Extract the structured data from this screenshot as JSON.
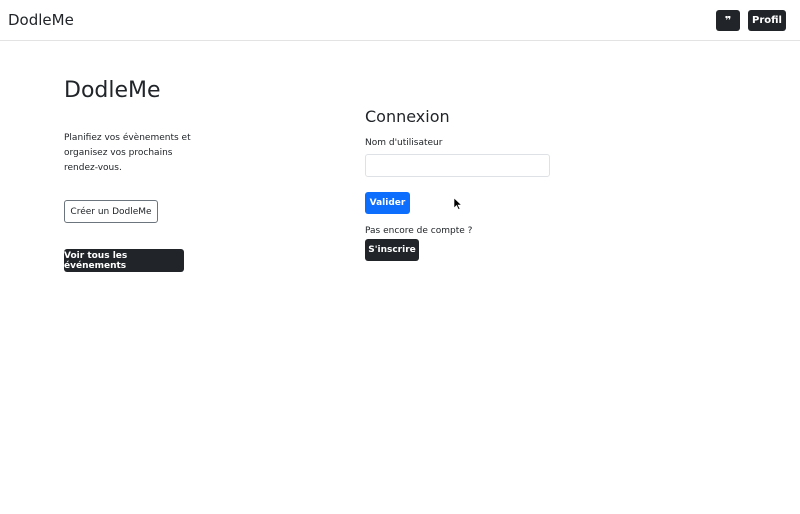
{
  "navbar": {
    "brand": "DodleMe",
    "icon_button_glyph": "❞",
    "icon_button_icon": "quote-icon",
    "profile_label": "Profil"
  },
  "hero": {
    "title": "DodleMe",
    "description": "Planifiez vos évènements et organisez vos prochains rendez-vous.",
    "create_label": "Créer un DodleMe",
    "all_events_label": "Voir tous les événements"
  },
  "login": {
    "title": "Connexion",
    "username_label": "Nom d'utilisateur",
    "username_value": "",
    "submit_label": "Valider",
    "no_account_text": "Pas encore de compte ?",
    "signup_label": "S'inscrire"
  },
  "colors": {
    "primary": "#0d6efd",
    "dark": "#212529",
    "border": "#dee2e6"
  }
}
